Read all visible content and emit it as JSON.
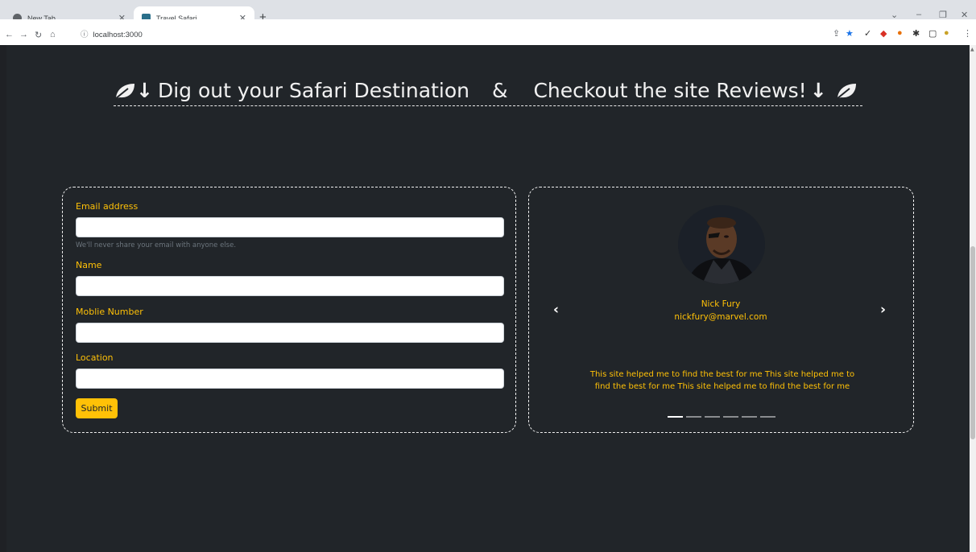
{
  "browser": {
    "tabs": [
      {
        "label": "New Tab",
        "active": false
      },
      {
        "label": "Travel Safari",
        "active": true
      }
    ],
    "url": "localhost:3000"
  },
  "page": {
    "heading": {
      "left": "Dig out your Safari Destination",
      "amp": "&",
      "right": "Checkout the site Reviews!"
    },
    "form": {
      "email_label": "Email address",
      "email_help": "We'll never share your email with anyone else.",
      "name_label": "Name",
      "mobile_label": "Moblie Number",
      "location_label": "Location",
      "submit_label": "Submit"
    },
    "review": {
      "name": "Nick Fury",
      "email": "nickfury@marvel.com",
      "text": "This site helped me to find the best for me This site helped me to find the best for me This site helped me to find the best for me",
      "indicator_count": 6,
      "active_indicator": 1
    }
  },
  "colors": {
    "accent": "#ffc107",
    "background": "#212529"
  }
}
